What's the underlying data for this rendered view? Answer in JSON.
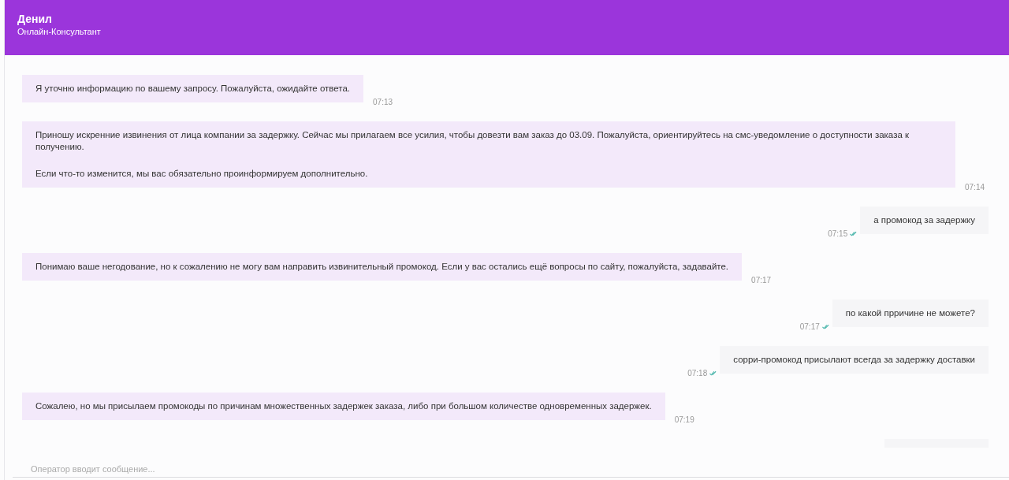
{
  "header": {
    "name": "Денил",
    "role": "Онлайн-Консультант"
  },
  "messages": [
    {
      "kind": "operator",
      "paragraphs": [
        "Я уточню информацию по вашему запросу. Пожалуйста, ожидайте ответа."
      ],
      "time": "07:13"
    },
    {
      "kind": "operator",
      "paragraphs": [
        "Приношу искренние извинения от лица компании за задержку. Сейчас мы прилагаем все усилия, чтобы довезти вам заказ до 03.09. Пожалуйста, ориентируйтесь на смс-уведомление о доступности заказа к получению.",
        "Если что-то изменится, мы вас обязательно проинформируем дополнительно."
      ],
      "time": "07:14"
    },
    {
      "kind": "client",
      "paragraphs": [
        "а промокод за задержку"
      ],
      "time": "07:15",
      "read": true
    },
    {
      "kind": "operator",
      "paragraphs": [
        "Понимаю ваше негодование, но к сожалению не могу вам направить извинительный промокод. Если у вас остались ещё вопросы по сайту, пожалуйста, задавайте."
      ],
      "time": "07:17"
    },
    {
      "kind": "client",
      "paragraphs": [
        "по какой прричине не можете?"
      ],
      "time": "07:17",
      "read": true
    },
    {
      "kind": "client",
      "paragraphs": [
        "сорри-промокод присылают всегда за задержку доставки"
      ],
      "time": "07:18",
      "read": true
    },
    {
      "kind": "operator",
      "paragraphs": [
        "Сожалею, но мы присылаем промокоды по причинам множественных задержек заказа, либо при большом количестве одновременных задержек."
      ],
      "time": "07:19"
    }
  ],
  "typing_status": "Оператор вводит сообщение..."
}
